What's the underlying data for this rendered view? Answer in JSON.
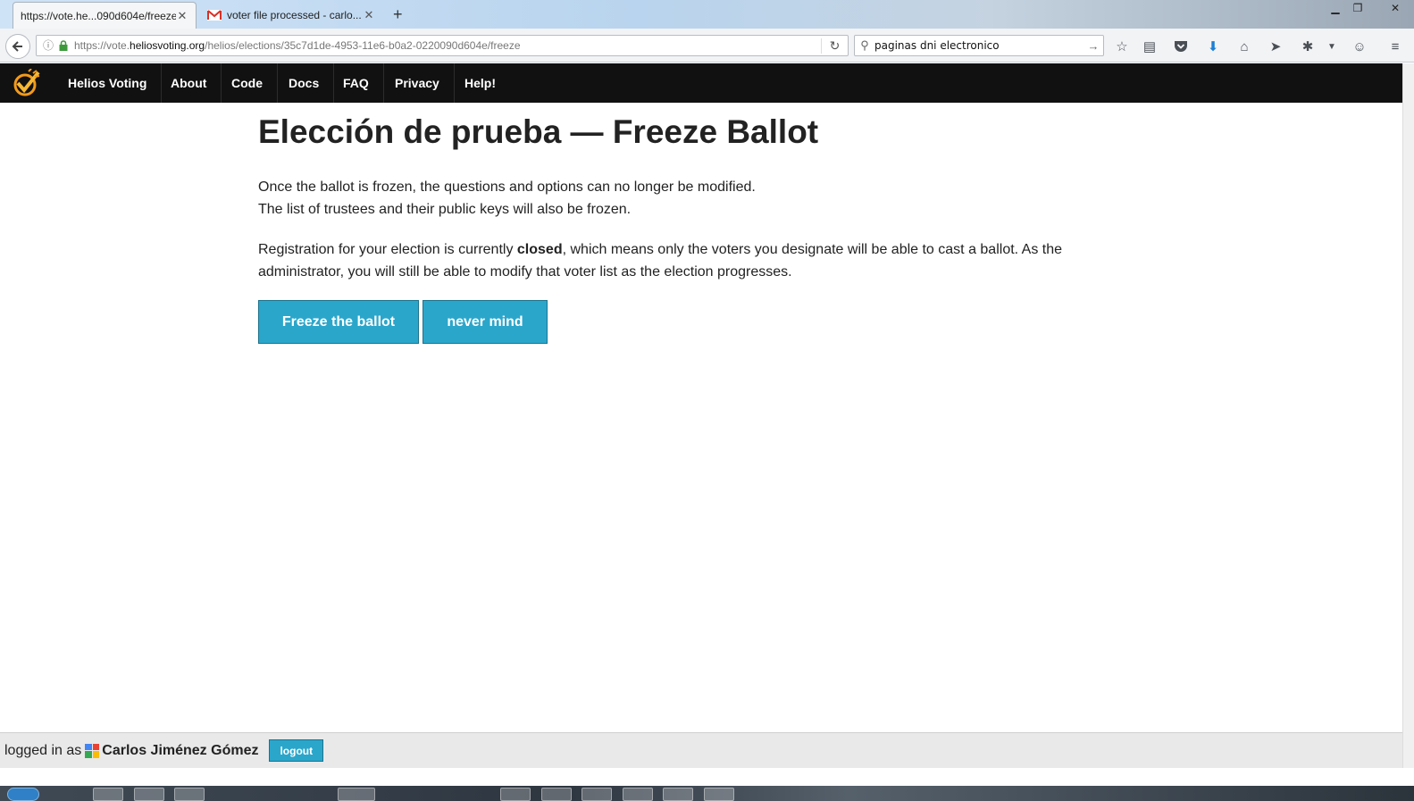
{
  "browser": {
    "tabs": [
      {
        "title": "https://vote.he...090d604e/freeze",
        "active": true
      },
      {
        "title": "voter file processed - carlo...",
        "active": false
      }
    ],
    "url": {
      "prefix": "https://vote.",
      "domain": "heliosvoting.org",
      "path": "/helios/elections/35c7d1de-4953-11e6-b0a2-0220090d604e/freeze"
    },
    "search_value": "paginas dni electronico",
    "icons": [
      "back-arrow-icon",
      "info-icon",
      "lock-icon",
      "reload-icon",
      "search-icon",
      "go-arrow-icon",
      "star-icon",
      "reading-list-icon",
      "pocket-icon",
      "download-icon",
      "home-icon",
      "send-icon",
      "extension-icon",
      "dropdown-icon",
      "chat-icon",
      "menu-icon"
    ]
  },
  "site": {
    "nav": [
      "Helios Voting",
      "About",
      "Code",
      "Docs",
      "FAQ",
      "Privacy",
      "Help!"
    ]
  },
  "page": {
    "title": "Elección de prueba — Freeze Ballot",
    "para1_line1": "Once the ballot is frozen, the questions and options can no longer be modified.",
    "para1_line2": "The list of trustees and their public keys will also be frozen.",
    "para2_before": "Registration for your election is currently ",
    "para2_bold": "closed",
    "para2_after": ", which means only the voters you designate will be able to cast a ballot. As the administrator, you will still be able to modify that voter list as the election progresses.",
    "freeze_button": "Freeze the ballot",
    "nevermind_button": "never mind"
  },
  "footer": {
    "logged_in_label": "logged in as",
    "username": "Carlos Jiménez Gómez",
    "logout_label": "logout"
  },
  "colors": {
    "button_blue": "#2ba6cb",
    "header_black": "#111111",
    "footer_gray": "#e9e9e9"
  }
}
